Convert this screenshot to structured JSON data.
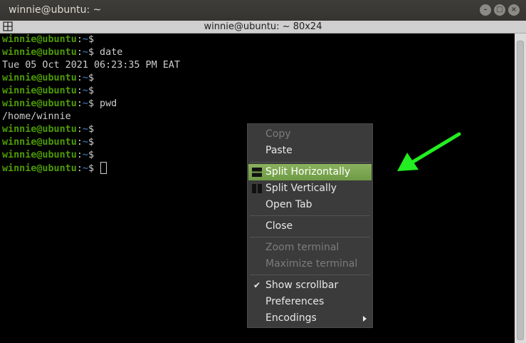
{
  "window": {
    "title": "winnie@ubuntu: ~",
    "buttons": [
      "minimize",
      "maximize",
      "close"
    ]
  },
  "terminator": {
    "title": "winnie@ubuntu: ~ 80x24"
  },
  "terminal": {
    "prompt_user": "winnie@ubuntu",
    "prompt_sep": ":",
    "prompt_path": "~",
    "prompt_dollar": "$",
    "lines": [
      {
        "type": "prompt",
        "cmd": ""
      },
      {
        "type": "prompt",
        "cmd": " date"
      },
      {
        "type": "output",
        "text": "Tue 05 Oct 2021 06:23:35 PM EAT"
      },
      {
        "type": "prompt",
        "cmd": ""
      },
      {
        "type": "prompt",
        "cmd": ""
      },
      {
        "type": "prompt",
        "cmd": " pwd"
      },
      {
        "type": "output",
        "text": "/home/winnie"
      },
      {
        "type": "prompt",
        "cmd": ""
      },
      {
        "type": "prompt",
        "cmd": ""
      },
      {
        "type": "prompt",
        "cmd": ""
      },
      {
        "type": "prompt",
        "cmd": " ",
        "cursor": true
      }
    ]
  },
  "context_menu": {
    "items": [
      {
        "label": "Copy",
        "disabled": true
      },
      {
        "label": "Paste"
      },
      {
        "label": "Split Horizontally",
        "highlight": true,
        "icon": "split-horizontal-icon"
      },
      {
        "label": "Split Vertically",
        "icon": "split-vertical-icon"
      },
      {
        "label": "Open Tab"
      },
      {
        "label": "Close"
      },
      {
        "label": "Zoom terminal",
        "disabled": true
      },
      {
        "label": "Maximize terminal",
        "disabled": true
      },
      {
        "label": "Show scrollbar",
        "checked": true
      },
      {
        "label": "Preferences"
      },
      {
        "label": "Encodings",
        "submenu": true
      }
    ]
  },
  "colors": {
    "prompt_user": "#4e9a06",
    "prompt_path": "#3465a4",
    "menu_highlight": "#7aa653",
    "annotation_arrow": "#22ee22"
  }
}
